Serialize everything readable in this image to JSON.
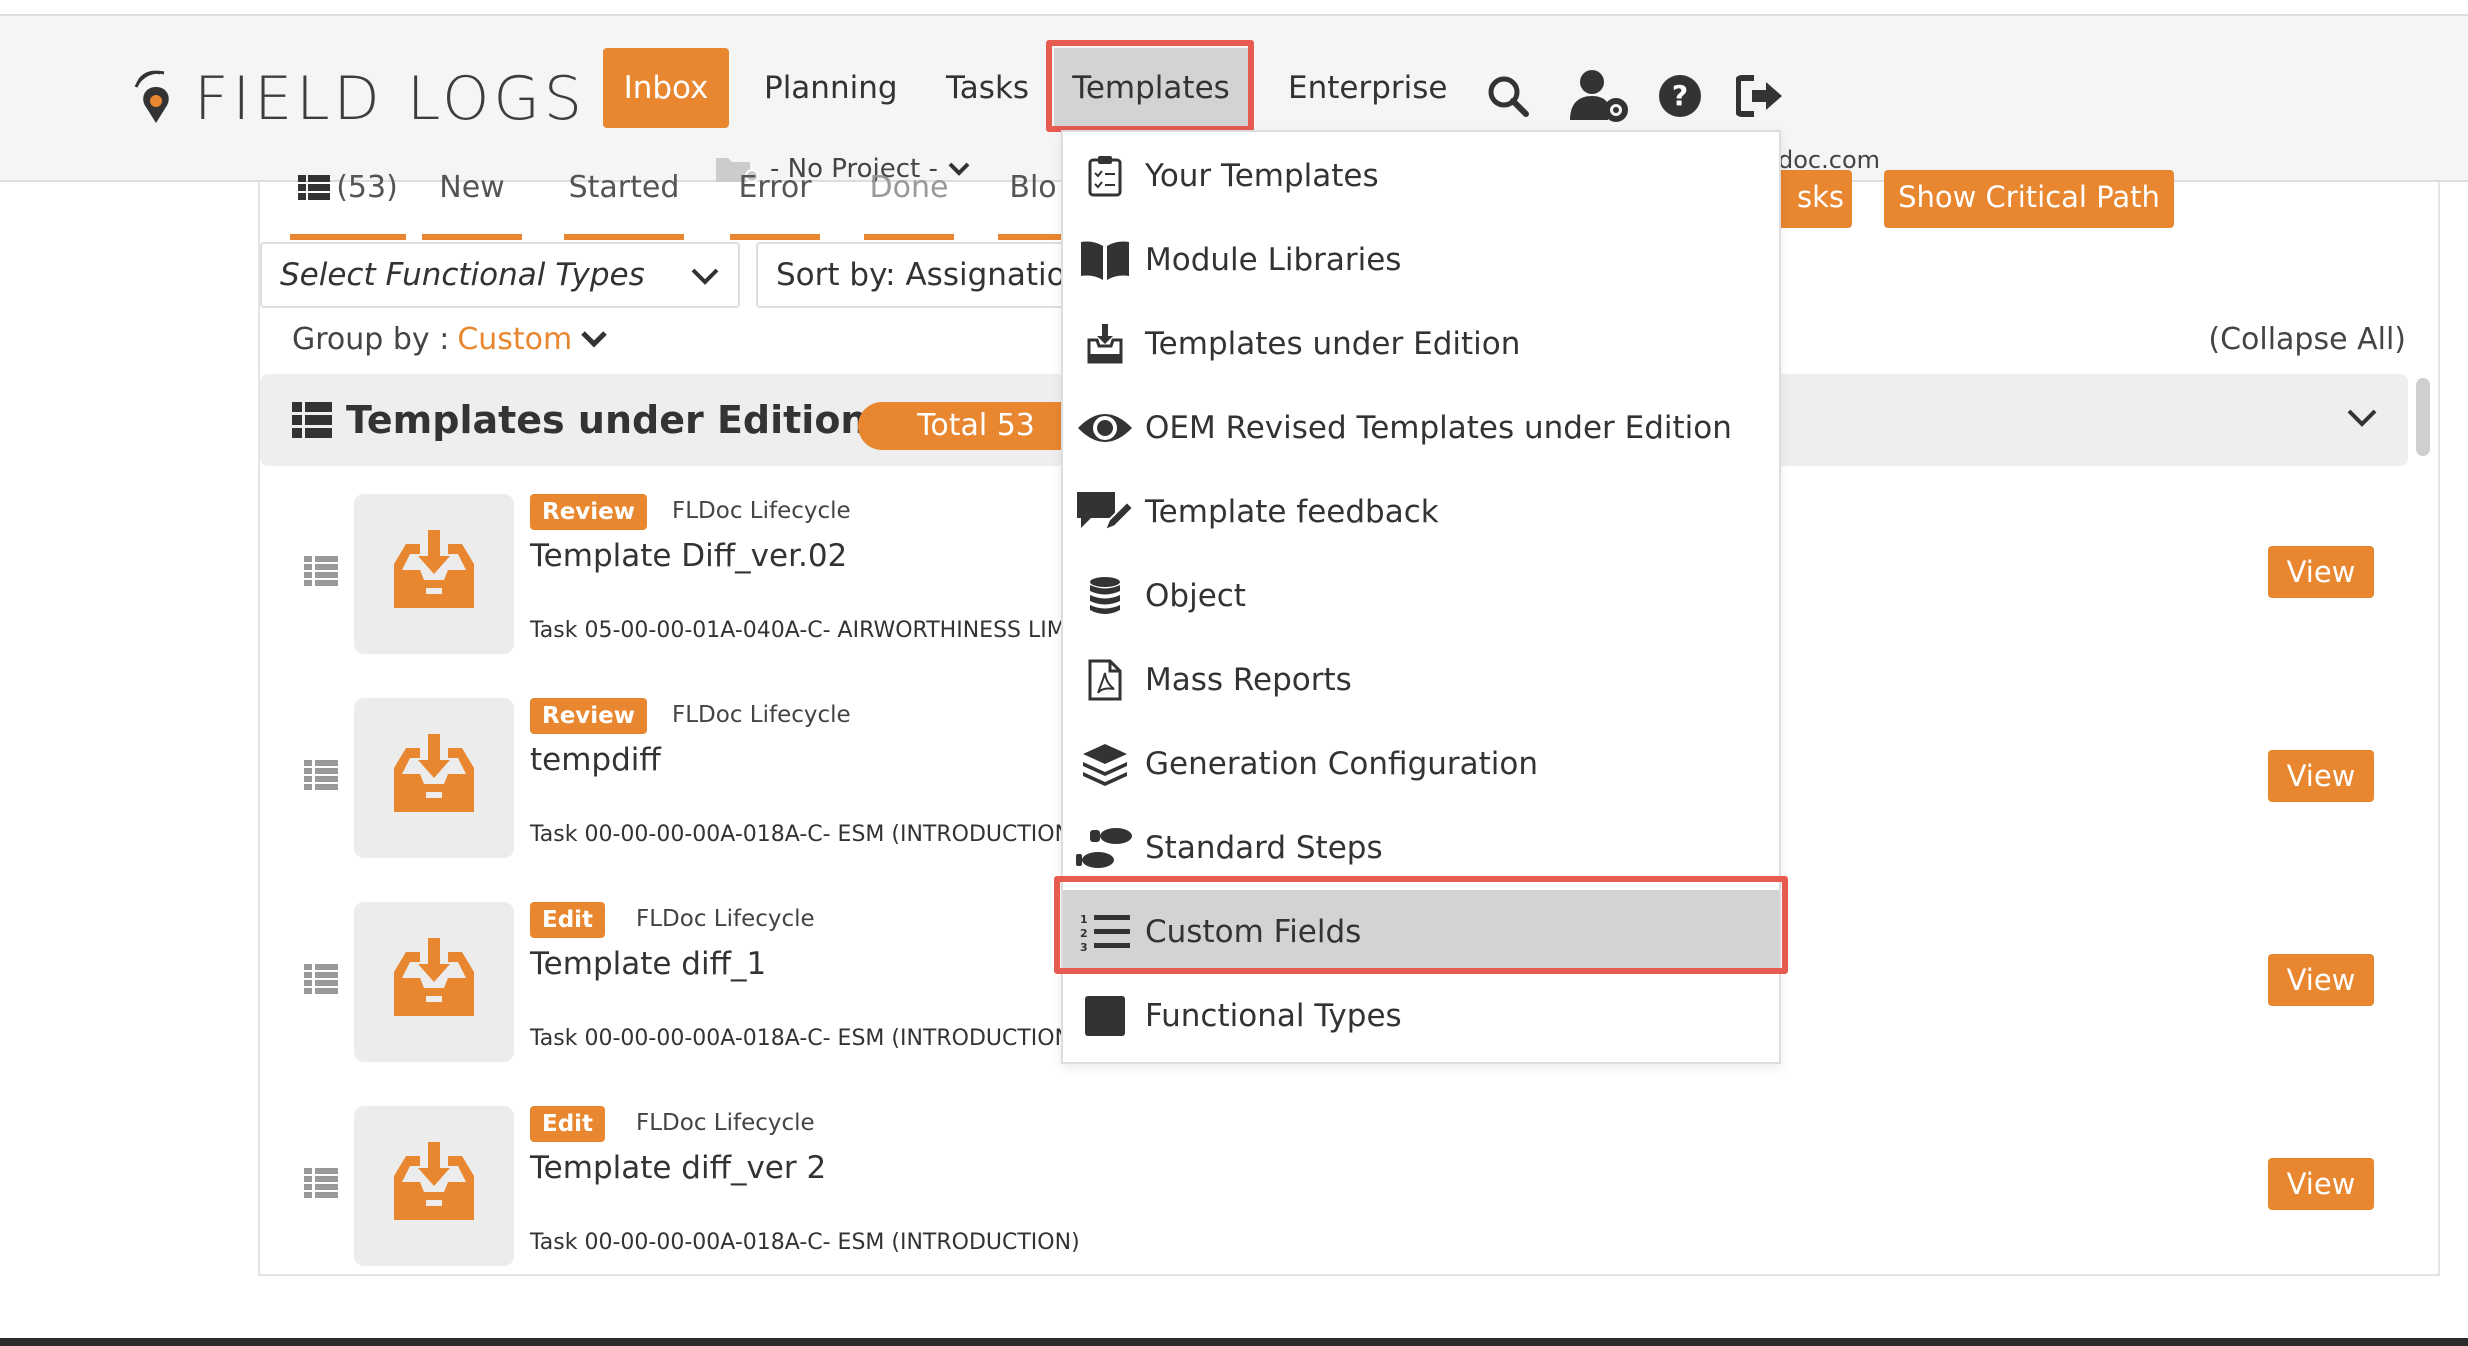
{
  "brand": {
    "name": "FIELD LOGS"
  },
  "nav": {
    "items": [
      {
        "label": "Inbox",
        "active": true
      },
      {
        "label": "Planning"
      },
      {
        "label": "Tasks"
      },
      {
        "label": "Templates",
        "open": true
      },
      {
        "label": "Enterprise"
      }
    ],
    "icons": [
      "search-icon",
      "user-settings-icon",
      "help-icon",
      "logout-icon"
    ]
  },
  "project": {
    "label": "- No Project -"
  },
  "user": {
    "email_fragment": "doc.com"
  },
  "toolbar": {
    "tabs": [
      {
        "label": "(53)",
        "icon": "list-icon"
      },
      {
        "label": "New"
      },
      {
        "label": "Started"
      },
      {
        "label": "Error"
      },
      {
        "label": "Done"
      },
      {
        "label": "Blo"
      }
    ],
    "functional_types_placeholder": "Select Functional Types",
    "sort_label": "Sort by: Assignation",
    "tasks_button": "sks",
    "critical_path_button": "Show Critical Path"
  },
  "grouping": {
    "label": "Group by :",
    "value": "Custom",
    "collapse_all": "(Collapse All)"
  },
  "group": {
    "title": "Templates under Edition",
    "total": "Total 53"
  },
  "rows": [
    {
      "status": "Review",
      "lifecycle": "FLDoc Lifecycle",
      "title": "Template Diff_ver.02",
      "task": "Task 05-00-00-01A-040A-C- AIRWORTHINESS LIM",
      "view": "View"
    },
    {
      "status": "Review",
      "lifecycle": "FLDoc Lifecycle",
      "title": "tempdiff",
      "task": "Task 00-00-00-00A-018A-C- ESM (INTRODUCTION",
      "view": "View"
    },
    {
      "status": "Edit",
      "lifecycle": "FLDoc Lifecycle",
      "title": "Template diff_1",
      "task": "Task 00-00-00-00A-018A-C- ESM (INTRODUCTION",
      "view": "View"
    },
    {
      "status": "Edit",
      "lifecycle": "FLDoc Lifecycle",
      "title": "Template diff_ver 2",
      "task": "Task 00-00-00-00A-018A-C- ESM (INTRODUCTION)",
      "view": "View"
    }
  ],
  "templates_menu": {
    "items": [
      {
        "label": "Your Templates",
        "icon": "clipboard-checklist-icon"
      },
      {
        "label": "Module Libraries",
        "icon": "book-icon"
      },
      {
        "label": "Templates under Edition",
        "icon": "inbox-download-icon"
      },
      {
        "label": "OEM Revised Templates under Edition",
        "icon": "eye-icon"
      },
      {
        "label": "Template feedback",
        "icon": "comment-edit-icon"
      },
      {
        "label": "Object",
        "icon": "database-icon"
      },
      {
        "label": "Mass Reports",
        "icon": "pdf-file-icon"
      },
      {
        "label": "Generation Configuration",
        "icon": "layers-icon"
      },
      {
        "label": "Standard Steps",
        "icon": "shoe-prints-icon"
      },
      {
        "label": "Custom Fields",
        "icon": "numbered-list-icon",
        "highlighted": true
      },
      {
        "label": "Functional Types",
        "icon": "square-icon"
      }
    ]
  },
  "colors": {
    "accent": "#e8872f",
    "highlight": "#e65a50",
    "menu_active": "#d3d3d3"
  }
}
